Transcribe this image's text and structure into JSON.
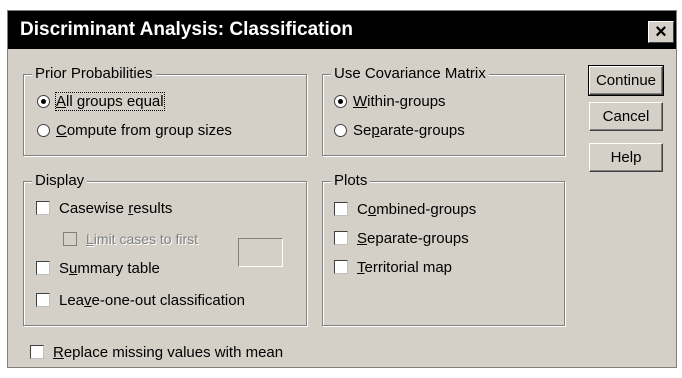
{
  "window": {
    "title": "Discriminant Analysis: Classification",
    "close_label": "×"
  },
  "prior": {
    "legend": "Prior Probabilities",
    "all_equal": {
      "pre": "",
      "key": "A",
      "post": "ll groups equal",
      "selected": true
    },
    "from_sizes": {
      "pre": "",
      "key": "C",
      "post": "ompute from group sizes",
      "selected": false
    }
  },
  "covariance": {
    "legend": "Use Covariance Matrix",
    "within": {
      "pre": "",
      "key": "W",
      "post": "ithin-groups",
      "selected": true
    },
    "separate": {
      "pre": "Se",
      "key": "p",
      "post": "arate-groups",
      "selected": false
    }
  },
  "display": {
    "legend": "Display",
    "casewise": {
      "pre": "Casewise ",
      "key": "r",
      "post": "esults",
      "checked": false
    },
    "limit": {
      "pre": "",
      "key": "L",
      "post": "imit cases to first",
      "checked": false,
      "value": ""
    },
    "summary": {
      "pre": "S",
      "key": "u",
      "post": "mmary table",
      "checked": false
    },
    "leave_one_out": {
      "pre": "Lea",
      "key": "v",
      "post": "e-one-out classification",
      "checked": false
    }
  },
  "plots": {
    "legend": "Plots",
    "combined": {
      "pre": "C",
      "key": "o",
      "post": "mbined-groups",
      "checked": false
    },
    "separate": {
      "pre": "",
      "key": "S",
      "post": "eparate-groups",
      "checked": false
    },
    "territorial": {
      "pre": "",
      "key": "T",
      "post": "erritorial map",
      "checked": false
    }
  },
  "replace_missing": {
    "pre": "",
    "key": "R",
    "post": "eplace missing values with mean",
    "checked": false
  },
  "buttons": {
    "continue": "Continue",
    "cancel": "Cancel",
    "help": "Help"
  }
}
